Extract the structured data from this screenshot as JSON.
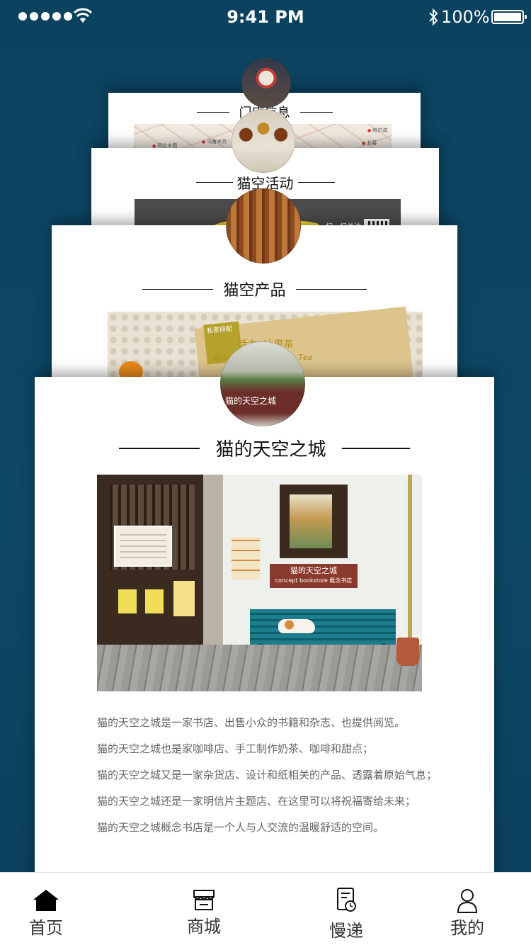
{
  "status_bar": {
    "time": "9:41 PM",
    "battery": "100%"
  },
  "cards": {
    "store": {
      "title": "门店信息",
      "map_cities": [
        "阿拉木图",
        "乌鲁木齐",
        "哈尔滨",
        "长春"
      ]
    },
    "activity": {
      "title": "猫空活动",
      "qr_text": "扫一扫关注"
    },
    "product": {
      "title": "猫空产品",
      "tag_label": "活力:冰果茶",
      "tag_sub": "Dynamic ice Fruit Tea",
      "tag_green": "私家研配"
    },
    "main": {
      "title": "猫的天空之城",
      "photo_sign": "猫的天空之城",
      "photo_sign_sub": "concept bookstore 概念书店",
      "thumb_text": "猫的天空之城",
      "description": [
        "猫的天空之城是一家书店、出售小众的书籍和杂志、也提供阅览。",
        "猫的天空之城也是家咖啡店、手工制作奶茶、咖啡和甜点；",
        "猫的天空之城又是一家杂货店、设计和纸相关的产品、透露着原始气息；",
        "猫的天空之城还是一家明信片主题店、在这里可以将祝福寄给未来；",
        "猫的天空之城概念书店是一个人与人交流的温暖舒适的空间。"
      ]
    }
  },
  "tab_bar": {
    "home": "首页",
    "mall": "商城",
    "delivery": "慢递",
    "mine": "我的"
  },
  "icons": {
    "home": "home-icon",
    "mall": "store-icon",
    "delivery": "clock-document-icon",
    "mine": "person-icon"
  },
  "colors": {
    "background": "#0c4562",
    "card": "#ffffff",
    "text": "#111111",
    "description": "#666666"
  }
}
